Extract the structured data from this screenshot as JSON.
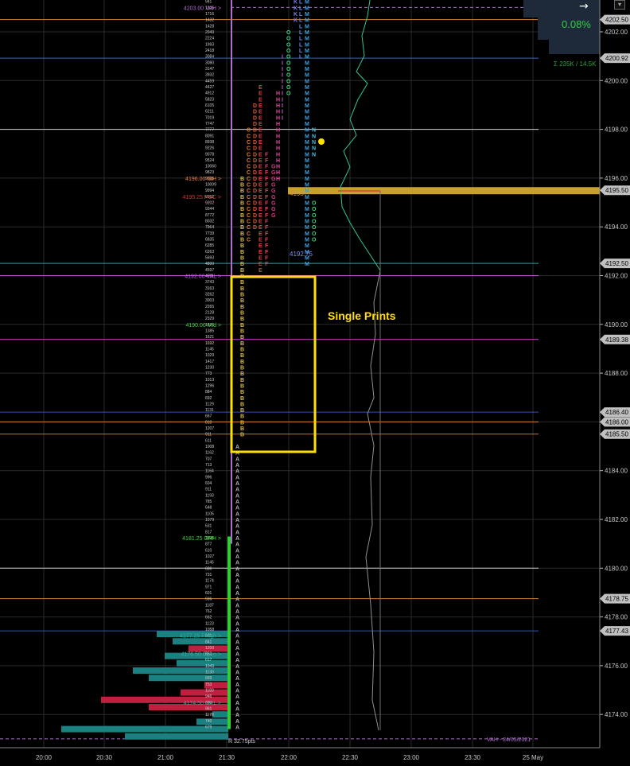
{
  "chart_data": {
    "type": "market_profile",
    "y_axis": {
      "range": [
        4172.9,
        4204.4
      ],
      "ticks": [
        4202.0,
        4200.0,
        4198.0,
        4196.0,
        4194.0,
        4192.0,
        4190.0,
        4188.0,
        4186.0,
        4184.0,
        4182.0,
        4180.0,
        4178.0,
        4176.0,
        4174.0
      ],
      "tick_labels": [
        "4202.00",
        "4200.00",
        "4198.00",
        "4196.00",
        "4194.00",
        "4192.00",
        "4190.00",
        "4188.00",
        "4186.00",
        "4184.00",
        "4182.00",
        "4180.00",
        "4178.00",
        "4176.00",
        "4174.00"
      ]
    },
    "x_axis": {
      "ticks": [
        "20:00",
        "20:30",
        "21:00",
        "21:30",
        "22:00",
        "22:30",
        "23:00",
        "23:30",
        "25 May"
      ]
    },
    "price_markers": [
      {
        "price": 4202.5,
        "label": "4202.50",
        "color": "#c0c0c0"
      },
      {
        "price": 4200.92,
        "label": "4200.92",
        "color": "#c0c0c0"
      },
      {
        "price": 4195.5,
        "label": "4195.50",
        "color": "#c0c0c0"
      },
      {
        "price": 4192.5,
        "label": "4192.50",
        "color": "#c0c0c0"
      },
      {
        "price": 4189.38,
        "label": "4189.38",
        "color": "#c0c0c0"
      },
      {
        "price": 4186.4,
        "label": "4186.40",
        "color": "#c0c0c0"
      },
      {
        "price": 4186.0,
        "label": "4186.00",
        "color": "#c0c0c0"
      },
      {
        "price": 4185.5,
        "label": "4185.50",
        "color": "#c0c0c0"
      },
      {
        "price": 4178.75,
        "label": "4178.75",
        "color": "#c0c0c0"
      },
      {
        "price": 4177.43,
        "label": "4177.43",
        "color": "#c0c0c0"
      }
    ],
    "level_labels": [
      {
        "price": 4203.0,
        "text": "4203.00 VAH",
        "color": "#b070d0"
      },
      {
        "price": 4196.0,
        "text": "4196.00 IBH",
        "color": "#f08040"
      },
      {
        "price": 4195.25,
        "text": "4195.25 POC",
        "color": "#e03030"
      },
      {
        "price": 4192.0,
        "text": "4192.00 VAL",
        "color": "#b070d0"
      },
      {
        "price": 4190.0,
        "text": "4190.00 Mid",
        "color": "#40d040"
      },
      {
        "price": 4181.25,
        "text": "4181.25 ORH",
        "color": "#40d040"
      },
      {
        "price": 4177.25,
        "text": "4177.25 FHigh",
        "color": "#30b0a0"
      },
      {
        "price": 4176.5,
        "text": "4176.50 Open",
        "color": "#30b0a0"
      },
      {
        "price": 4174.5,
        "text": "4174.50 ORL",
        "color": "#30b0a0"
      }
    ],
    "annotations": {
      "single_prints": "Single Prints",
      "percent_change": "0.08%",
      "volume_text": "Σ 235K / 14.5K",
      "poc_inline": "4195",
      "val_inline": "4192.75",
      "range_text": "R 32.75pts",
      "prior_vah": "VAH - 24/05/2021"
    },
    "colors": {
      "A": "#b0b0b0",
      "B": "#d8c040",
      "C": "#e08030",
      "D": "#e05a30",
      "E": "#e04040",
      "F": "#e04060",
      "G": "#d04080",
      "H": "#e050a0",
      "I": "#c060d0",
      "J": "#a070e0",
      "K": "#8080f0",
      "L": "#6090f0",
      "M": "#40a0e0",
      "N": "#50c0e0",
      "O": "#40d080",
      "single_prints_box": "#ffe000",
      "poc_band": "#c8a030"
    }
  }
}
